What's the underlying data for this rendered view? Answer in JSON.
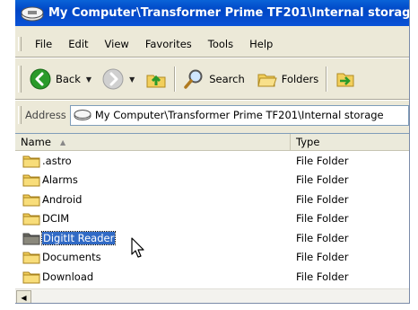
{
  "window": {
    "title": "My Computer\\Transformer Prime TF201\\Internal storage"
  },
  "menu": [
    "File",
    "Edit",
    "View",
    "Favorites",
    "Tools",
    "Help"
  ],
  "toolbar": {
    "back_label": "Back",
    "search_label": "Search",
    "folders_label": "Folders"
  },
  "address": {
    "label": "Address",
    "value": "My Computer\\Transformer Prime TF201\\Internal storage"
  },
  "columns": {
    "name": "Name",
    "type": "Type"
  },
  "files": [
    {
      "name": ".astro",
      "type": "File Folder"
    },
    {
      "name": "Alarms",
      "type": "File Folder"
    },
    {
      "name": "Android",
      "type": "File Folder"
    },
    {
      "name": "DCIM",
      "type": "File Folder"
    },
    {
      "name": "DigitIt Reader",
      "type": "File Folder",
      "selected": true
    },
    {
      "name": "Documents",
      "type": "File Folder"
    },
    {
      "name": "Download",
      "type": "File Folder"
    }
  ],
  "colors": {
    "title_bar": "#0046c6",
    "selection": "#316ac5",
    "folder": "#f2cf5b"
  }
}
